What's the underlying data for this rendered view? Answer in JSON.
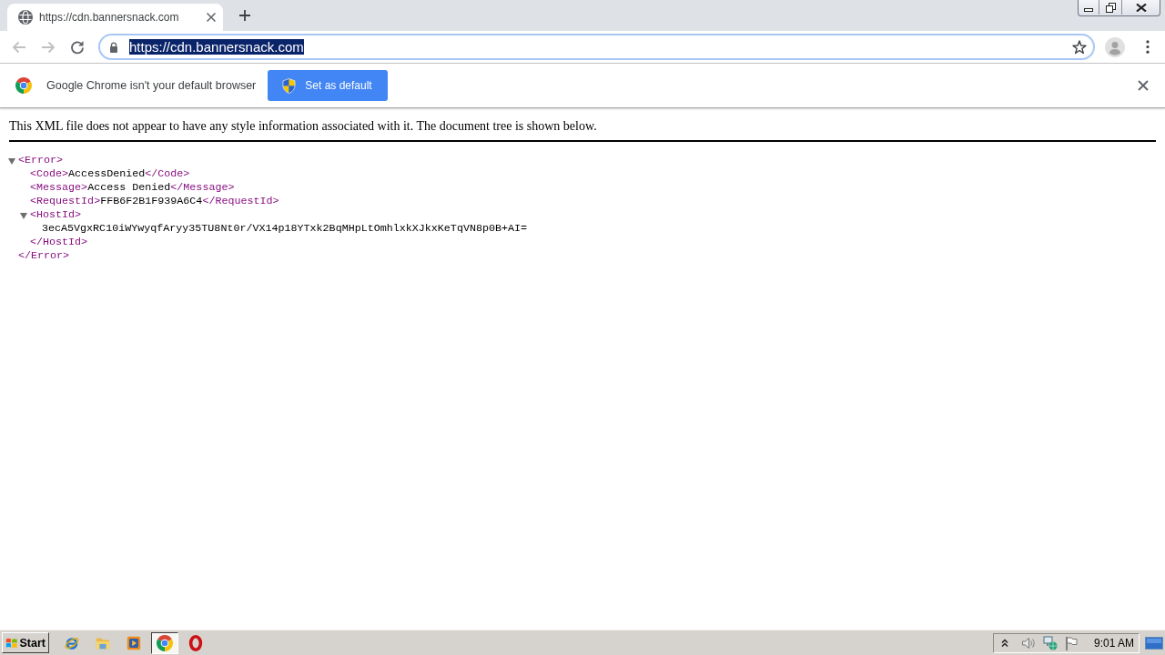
{
  "browser": {
    "tab": {
      "title": "https://cdn.bannersnack.com",
      "selected": true
    },
    "address": {
      "url": "https://cdn.bannersnack.com",
      "selected": true
    }
  },
  "navigation": [
    {
      "kind": "back",
      "disabled": true
    },
    {
      "kind": "forward",
      "disabled": true
    },
    {
      "kind": "reload",
      "disabled": false
    }
  ],
  "infobar": {
    "message": "Google Chrome isn't your default browser",
    "button": "Set as default"
  },
  "xml_viewer": {
    "notice": "This XML file does not appear to have any style information associated with it. The document tree is shown below.",
    "tree": {
      "open": "<Error>",
      "expanded": true,
      "children": [
        {
          "open": "<Code>",
          "text": "AccessDenied",
          "close": "</Code>"
        },
        {
          "open": "<Message>",
          "text": "Access Denied",
          "close": "</Message>"
        },
        {
          "open": "<RequestId>",
          "text": "FFB6F2B1F939A6C4",
          "close": "</RequestId>"
        },
        {
          "open": "<HostId>",
          "expanded": true,
          "children": [
            {
              "text": "3ecA5VgxRC10iWYwyqfAryy35TU8Nt0r/VX14p18YTxk2BqMHpLtOmhlxkXJkxKeTqVN8p0B+AI="
            }
          ],
          "close": "</HostId>"
        }
      ],
      "close": "</Error>"
    }
  },
  "taskbar": {
    "start": "Start",
    "apps": [
      {
        "kind": "e-browser",
        "selected": false
      },
      {
        "kind": "folder",
        "selected": false
      },
      {
        "kind": "media-player",
        "selected": false
      },
      {
        "kind": "chrome",
        "selected": true
      },
      {
        "kind": "opera",
        "selected": false
      }
    ],
    "clock": "9:01 AM"
  }
}
